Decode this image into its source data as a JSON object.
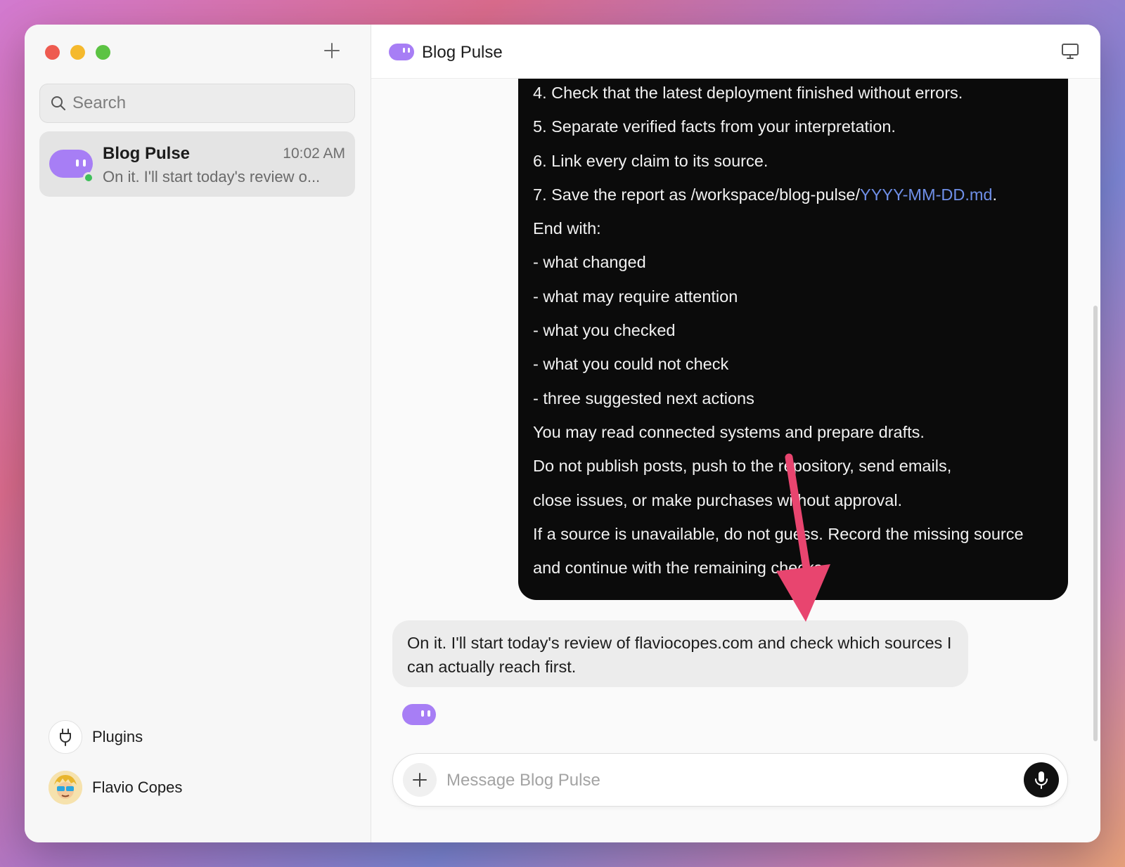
{
  "sidebar": {
    "search_placeholder": "Search",
    "chat": {
      "name": "Blog Pulse",
      "time": "10:02 AM",
      "preview": "On it. I'll start today's review o..."
    },
    "plugins_label": "Plugins",
    "user_name": "Flavio Copes"
  },
  "header": {
    "title": "Blog Pulse"
  },
  "conversation": {
    "user_message_lines": [
      "4. Check that the latest deployment finished without errors.",
      "5. Separate verified facts from your interpretation.",
      "6. Link every claim to its source.",
      "End with:",
      "- what changed",
      "- what may require attention",
      "- what you checked",
      "- what you could not check",
      "- three suggested next actions",
      "You may read connected systems and prepare drafts.",
      "Do not publish posts, push to the repository, send emails,",
      "close issues, or make purchases without approval.",
      "If a source is unavailable, do not guess. Record the missing source",
      "and continue with the remaining checks."
    ],
    "save_line_prefix": "7. Save the report as /workspace/blog-pulse/",
    "save_line_link": "YYYY-MM-DD.md",
    "save_line_suffix": ".",
    "assistant_message": "On it. I'll start today's review of flaviocopes.com and check which sources I can actually reach first."
  },
  "composer": {
    "placeholder": "Message Blog Pulse"
  },
  "colors": {
    "bot_accent": "#a77ef5",
    "online": "#3fbf5a",
    "link": "#6f8fe8",
    "arrow": "#e8456f"
  }
}
